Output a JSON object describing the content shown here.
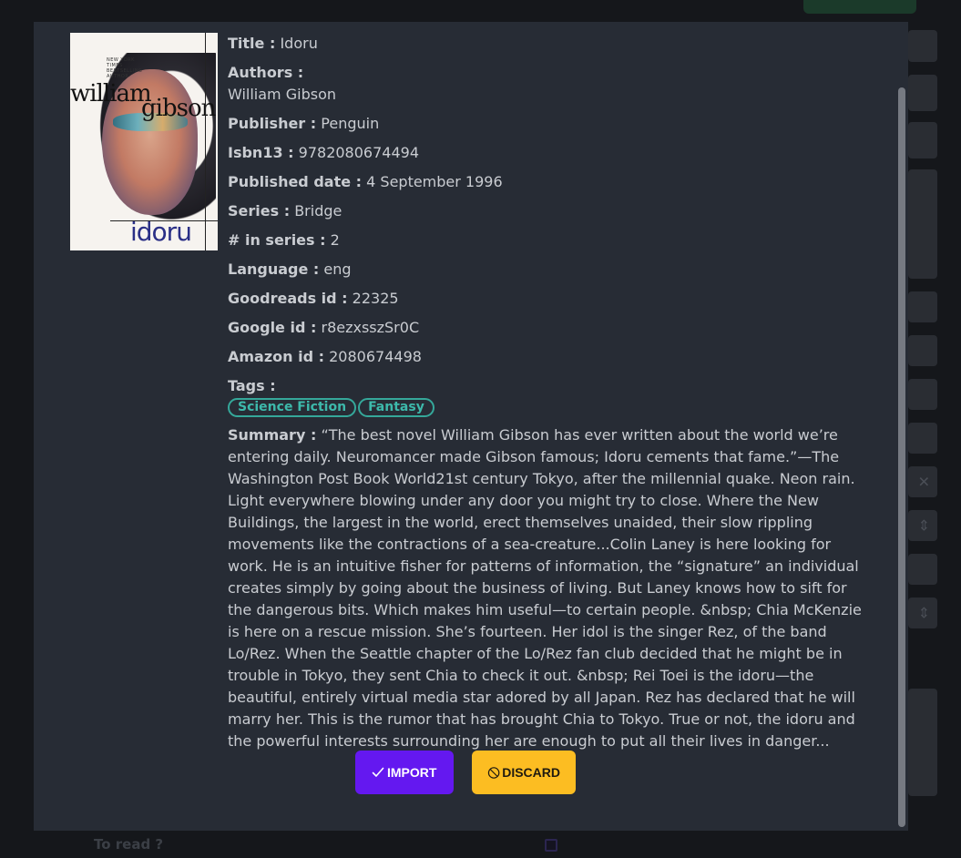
{
  "book": {
    "fields": {
      "title": {
        "label": "Title :",
        "value": "Idoru"
      },
      "authors": {
        "label": "Authors :",
        "value": "William Gibson"
      },
      "publisher": {
        "label": "Publisher :",
        "value": "Penguin"
      },
      "isbn13": {
        "label": "Isbn13 :",
        "value": "9782080674494"
      },
      "published_date": {
        "label": "Published date :",
        "value": "4 September 1996"
      },
      "series": {
        "label": "Series :",
        "value": "Bridge"
      },
      "series_number": {
        "label": "# in series :",
        "value": "2"
      },
      "language": {
        "label": "Language :",
        "value": "eng"
      },
      "goodreads_id": {
        "label": "Goodreads id :",
        "value": "22325"
      },
      "google_id": {
        "label": "Google id :",
        "value": "r8ezxsszSr0C"
      },
      "amazon_id": {
        "label": "Amazon id :",
        "value": "2080674498"
      }
    },
    "tags_label": "Tags :",
    "tags": [
      "Science Fiction",
      "Fantasy"
    ],
    "summary_label": "Summary :",
    "summary": "“The best novel William Gibson has ever written about the world we’re entering daily. Neuromancer made Gibson famous; Idoru cements that fame.”—The Washington Post Book World21st century Tokyo, after the millennial quake. Neon rain. Light everywhere blowing under any door you might try to close. Where the New Buildings, the largest in the world, erect themselves unaided, their slow rippling movements like the contractions of a sea-creature...Colin Laney is here looking for work. He is an intuitive fisher for patterns of information, the “signature” an individual creates simply by going about the business of living. But Laney knows how to sift for the dangerous bits. Which makes him useful—to certain people. &nbsp; Chia McKenzie is here on a rescue mission. She’s fourteen. Her idol is the singer Rez, of the band Lo/Rez. When the Seattle chapter of the Lo/Rez fan club decided that he might be in trouble in Tokyo, they sent Chia to check it out. &nbsp; Rei Toei is the idoru—the beautiful, entirely virtual media star adored by all Japan. Rez has declared that he will marry her. This is the rumor that has brought Chia to Tokyo. True or not, the idoru and the powerful interests surrounding her are enough to put all their lives in danger..."
  },
  "cover": {
    "top_text": "NEW YORK TIMES BESTSELLING AUTHOR",
    "author_line1": "william",
    "author_line2": "gibson",
    "title": "idoru"
  },
  "actions": {
    "import_label": "IMPORT",
    "discard_label": "DISCARD",
    "import_icon": "check-icon",
    "discard_icon": "ban-icon"
  },
  "background": {
    "to_read_label": "To read ?"
  },
  "colors": {
    "modal_bg": "#272c35",
    "import": "#6418f0",
    "discard": "#fcbd22",
    "tag": "#35a89a"
  }
}
